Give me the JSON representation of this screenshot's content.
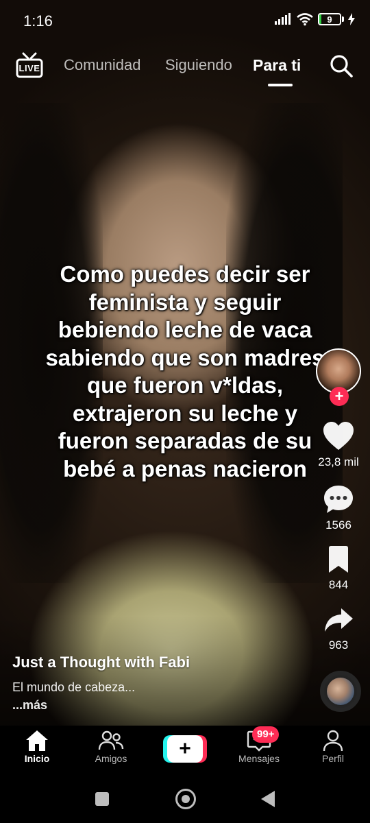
{
  "status_bar": {
    "time": "1:16",
    "battery_level": "9",
    "battery_fill_fraction": 0.09,
    "icons": [
      "signal-icon",
      "wifi-icon",
      "battery-icon",
      "charging-icon"
    ]
  },
  "top_nav": {
    "live_label": "LIVE",
    "tabs": [
      {
        "label": "Comunidad",
        "active": false
      },
      {
        "label": "Siguiendo",
        "active": false
      },
      {
        "label": "Para ti",
        "active": true
      }
    ]
  },
  "video": {
    "caption_lines": [
      "Como puedes decir ser",
      "feminista y seguir",
      "bebiendo leche de vaca",
      "sabiendo que son madres",
      "que fueron v*ldas,",
      "extrajeron su leche y",
      "fueron separadas de su",
      "bebé a penas nacieron"
    ],
    "author": "Just a Thought with Fabi",
    "description": "El mundo de cabeza...",
    "more_label": "...más"
  },
  "actions": {
    "likes": "23,8 mil",
    "comments": "1566",
    "saves": "844",
    "shares": "963",
    "follow_symbol": "+"
  },
  "bottom_nav": {
    "items": [
      {
        "label": "Inicio",
        "active": true
      },
      {
        "label": "Amigos",
        "active": false
      },
      {
        "label": "+",
        "active": false
      },
      {
        "label": "Mensajes",
        "active": false
      },
      {
        "label": "Perfil",
        "active": false
      }
    ],
    "messages_badge": "99+"
  },
  "colors": {
    "accent": "#fe2c55",
    "cyan": "#25f4ee",
    "battery_green": "#2ecc40"
  }
}
